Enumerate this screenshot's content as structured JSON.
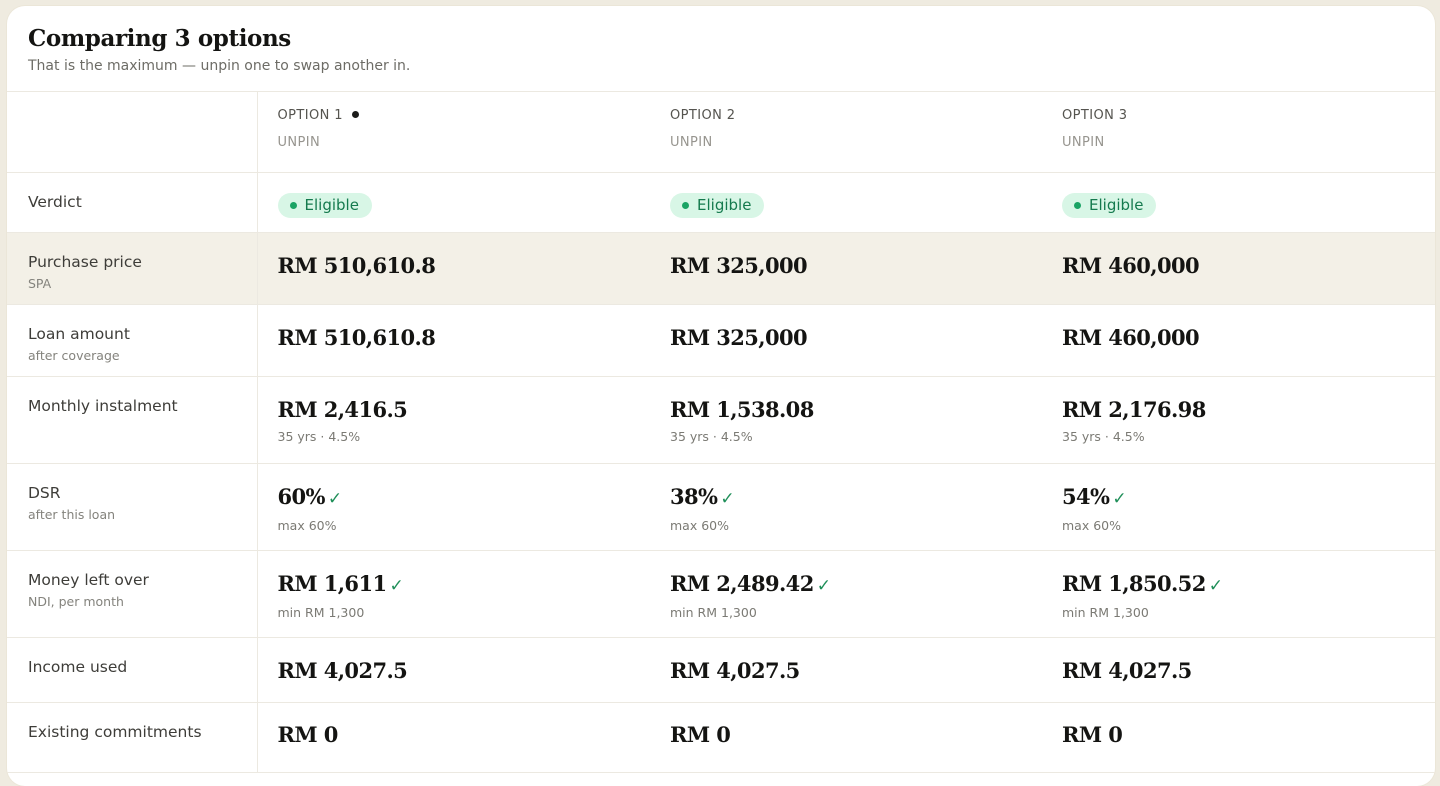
{
  "header": {
    "title": "Comparing 3 options",
    "subtitle": "That is the maximum — unpin one to swap another in."
  },
  "options": [
    {
      "name": "OPTION 1",
      "unpin": "UNPIN",
      "marked": true
    },
    {
      "name": "OPTION 2",
      "unpin": "UNPIN",
      "marked": false
    },
    {
      "name": "OPTION 3",
      "unpin": "UNPIN",
      "marked": false
    }
  ],
  "rows": {
    "verdict": {
      "label": "Verdict",
      "values": [
        "Eligible",
        "Eligible",
        "Eligible"
      ]
    },
    "purchase_price": {
      "label": "Purchase price",
      "sublabel": "SPA",
      "values": [
        "RM 510,610.8",
        "RM 325,000",
        "RM 460,000"
      ]
    },
    "loan_amount": {
      "label": "Loan amount",
      "sublabel": "after coverage",
      "values": [
        "RM 510,610.8",
        "RM 325,000",
        "RM 460,000"
      ]
    },
    "monthly_instalment": {
      "label": "Monthly instalment",
      "values": [
        "RM 2,416.5",
        "RM 1,538.08",
        "RM 2,176.98"
      ],
      "notes": [
        "35 yrs · 4.5%",
        "35 yrs · 4.5%",
        "35 yrs · 4.5%"
      ]
    },
    "dsr": {
      "label": "DSR",
      "sublabel": "after this loan",
      "values": [
        "60%",
        "38%",
        "54%"
      ],
      "notes": [
        "max 60%",
        "max 60%",
        "max 60%"
      ]
    },
    "money_left": {
      "label": "Money left over",
      "sublabel": "NDI, per month",
      "values": [
        "RM 1,611",
        "RM 2,489.42",
        "RM 1,850.52"
      ],
      "notes": [
        "min RM 1,300",
        "min RM 1,300",
        "min RM 1,300"
      ]
    },
    "income_used": {
      "label": "Income used",
      "values": [
        "RM 4,027.5",
        "RM 4,027.5",
        "RM 4,027.5"
      ]
    },
    "existing_commitments": {
      "label": "Existing commitments",
      "values": [
        "RM 0",
        "RM 0",
        "RM 0"
      ]
    }
  },
  "check_glyph": "✓",
  "colors": {
    "accent_green": "#1f8f59",
    "badge_bg": "#d8f6e6",
    "highlight_row": "#f3f0e7",
    "page_bg": "#efebe0"
  }
}
